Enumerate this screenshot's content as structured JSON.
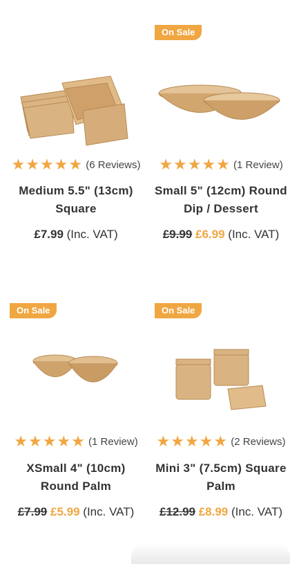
{
  "products": [
    {
      "name": "Medium 5.5\" (13cm) Square",
      "rating_stars": "★★★★★",
      "reviews": "(6 Reviews)",
      "on_sale": false,
      "price": "£7.99",
      "vat": "(Inc. VAT)"
    },
    {
      "badge": "On Sale",
      "name": "Small 5\" (12cm) Round Dip / Dessert",
      "rating_stars": "★★★★★",
      "reviews": "(1 Review)",
      "on_sale": true,
      "old_price": "£9.99",
      "price": "£6.99",
      "vat": "(Inc. VAT)"
    },
    {
      "badge": "On Sale",
      "name": "XSmall 4\" (10cm) Round Palm",
      "rating_stars": "★★★★★",
      "reviews": "(1 Review)",
      "on_sale": true,
      "old_price": "£7.99",
      "price": "£5.99",
      "vat": "(Inc. VAT)"
    },
    {
      "badge": "On Sale",
      "name": "Mini 3\" (7.5cm) Square Palm",
      "rating_stars": "★★★★★",
      "reviews": "(2 Reviews)",
      "on_sale": true,
      "old_price": "£12.99",
      "price": "£8.99",
      "vat": "(Inc. VAT)"
    }
  ],
  "colors": {
    "accent": "#f0a641",
    "text": "#333333",
    "leaf": "#c9a06a"
  }
}
